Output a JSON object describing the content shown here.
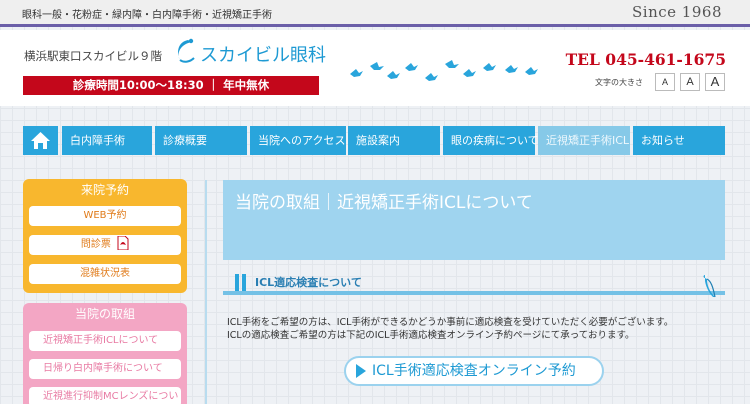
{
  "topbar": {
    "services": "眼科一般・花粉症・緑内障・白内障手術・近視矯正手術",
    "since": "Since 1968"
  },
  "header": {
    "location": "横浜駅東口スカイビル９階",
    "clinic_name": "スカイビル眼科",
    "hours": "診療時間10:00～18:30 ｜ 年中無休",
    "tel": "TEL 045-461-1675",
    "font_size_label": "文字の大きさ",
    "font_size_buttons": [
      "A",
      "A",
      "A"
    ]
  },
  "nav": {
    "home_icon": "home-icon",
    "items": [
      "白内障手術",
      "診療概要",
      "当院へのアクセス",
      "施設案内",
      "眼の疾病について",
      "近視矯正手術ICL",
      "お知らせ"
    ],
    "active_index": 5
  },
  "sidebar": {
    "reservation": {
      "title": "来院予約",
      "items": [
        "WEB予約",
        "問診票",
        "混雑状況表"
      ]
    },
    "initiatives": {
      "title": "当院の取組",
      "items": [
        "近視矯正手術ICLについて",
        "日帰り白内障手術について",
        "近視進行抑制MCレンズについて"
      ]
    }
  },
  "main": {
    "hero_title": "当院の取組｜近視矯正手術ICLについて",
    "section_title": "ICL適応検査について",
    "body_lines": [
      "ICL手術をご希望の方は、ICL手術ができるかどうか事前に適応検査を受けていただく必要がございます。",
      "ICLの適応検査ご希望の方は下記のICL手術適応検査オンライン予約ページにて承っております。"
    ],
    "cta_label": "ICL手術適応検査オンライン予約"
  },
  "colors": {
    "brand_blue": "#29a5dc",
    "hours_red": "#c4071b",
    "accent_purple": "#6b5fa8",
    "sidebar_orange": "#f8b72e",
    "sidebar_pink": "#f3a6c4"
  }
}
